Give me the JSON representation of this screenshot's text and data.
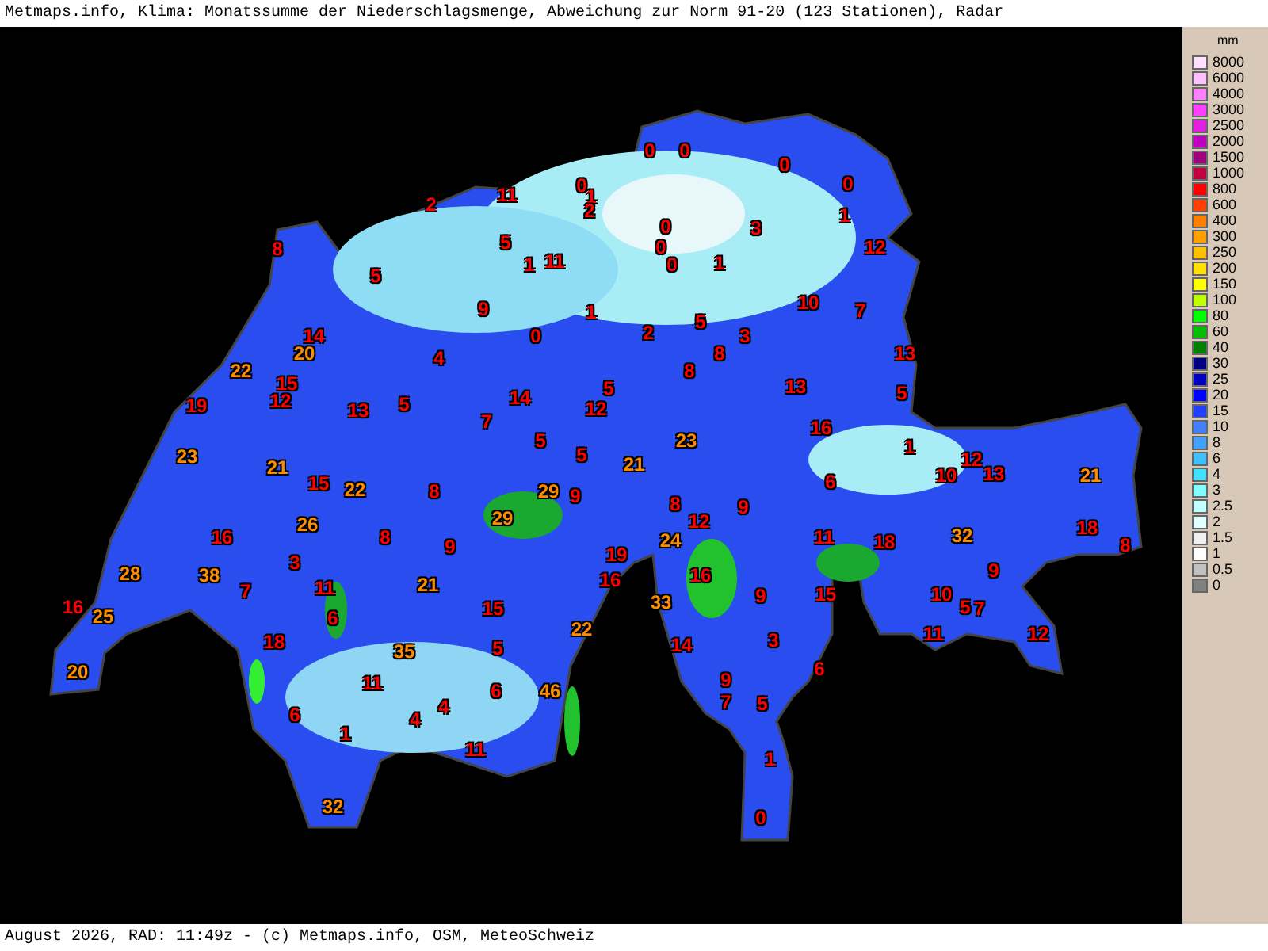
{
  "title": "Metmaps.info, Klima: Monatssumme der Niederschlagsmenge, Abweichung zur Norm 91-20 (123 Stationen), Radar",
  "legend": {
    "unit": "mm",
    "items": [
      {
        "label": "8000",
        "color": "#ffe0ff"
      },
      {
        "label": "6000",
        "color": "#ffc0ff"
      },
      {
        "label": "4000",
        "color": "#ff80ff"
      },
      {
        "label": "3000",
        "color": "#ff40ff"
      },
      {
        "label": "2500",
        "color": "#e020e0"
      },
      {
        "label": "2000",
        "color": "#c000c0"
      },
      {
        "label": "1500",
        "color": "#a00080"
      },
      {
        "label": "1000",
        "color": "#c00040"
      },
      {
        "label": "800",
        "color": "#ff0000"
      },
      {
        "label": "600",
        "color": "#ff4000"
      },
      {
        "label": "400",
        "color": "#ff8000"
      },
      {
        "label": "300",
        "color": "#ffa000"
      },
      {
        "label": "250",
        "color": "#ffc000"
      },
      {
        "label": "200",
        "color": "#ffe000"
      },
      {
        "label": "150",
        "color": "#ffff00"
      },
      {
        "label": "100",
        "color": "#c0ff00"
      },
      {
        "label": "80",
        "color": "#00ff00"
      },
      {
        "label": "60",
        "color": "#00c000"
      },
      {
        "label": "40",
        "color": "#008000"
      },
      {
        "label": "30",
        "color": "#000080"
      },
      {
        "label": "25",
        "color": "#0000c0"
      },
      {
        "label": "20",
        "color": "#0000ff"
      },
      {
        "label": "15",
        "color": "#2040ff"
      },
      {
        "label": "10",
        "color": "#4080ff"
      },
      {
        "label": "8",
        "color": "#40a0ff"
      },
      {
        "label": "6",
        "color": "#40c0ff"
      },
      {
        "label": "4",
        "color": "#40e0ff"
      },
      {
        "label": "3",
        "color": "#80ffff"
      },
      {
        "label": "2.5",
        "color": "#c0ffff"
      },
      {
        "label": "2",
        "color": "#e0ffff"
      },
      {
        "label": "1.5",
        "color": "#f0f0f0"
      },
      {
        "label": "1",
        "color": "#ffffff"
      },
      {
        "label": "0.5",
        "color": "#c0c0c0"
      },
      {
        "label": "0",
        "color": "#808080"
      }
    ]
  },
  "stations": [
    {
      "value": "0",
      "color": "#ff0000"
    },
    {
      "value": "0",
      "color": "#ff0000"
    },
    {
      "value": "0",
      "color": "#ff0000"
    },
    {
      "value": "0",
      "color": "#ff0000"
    },
    {
      "value": "1",
      "color": "#ff0000"
    },
    {
      "value": "11",
      "color": "#ff0000"
    },
    {
      "value": "0",
      "color": "#ff0000"
    },
    {
      "value": "1",
      "color": "#ff0000"
    },
    {
      "value": "2",
      "color": "#ff0000"
    },
    {
      "value": "2",
      "color": "#ff0000"
    },
    {
      "value": "8",
      "color": "#ff0000"
    },
    {
      "value": "5",
      "color": "#ff0000"
    },
    {
      "value": "5",
      "color": "#ff0000"
    },
    {
      "value": "1",
      "color": "#ff0000"
    },
    {
      "value": "11",
      "color": "#ff0000"
    },
    {
      "value": "0",
      "color": "#ff0000"
    },
    {
      "value": "0",
      "color": "#ff0000"
    },
    {
      "value": "0",
      "color": "#ff0000"
    },
    {
      "value": "1",
      "color": "#ff0000"
    },
    {
      "value": "3",
      "color": "#ff0000"
    },
    {
      "value": "12",
      "color": "#ff0000"
    },
    {
      "value": "9",
      "color": "#ff0000"
    },
    {
      "value": "1",
      "color": "#ff0000"
    },
    {
      "value": "0",
      "color": "#ff0000"
    },
    {
      "value": "2",
      "color": "#ff0000"
    },
    {
      "value": "5",
      "color": "#ff0000"
    },
    {
      "value": "3",
      "color": "#ff0000"
    },
    {
      "value": "8",
      "color": "#ff0000"
    },
    {
      "value": "8",
      "color": "#ff0000"
    },
    {
      "value": "10",
      "color": "#ff0000"
    },
    {
      "value": "7",
      "color": "#ff0000"
    },
    {
      "value": "14",
      "color": "#ff0000"
    },
    {
      "value": "20",
      "color": "#ff8c00"
    },
    {
      "value": "4",
      "color": "#ff0000"
    },
    {
      "value": "22",
      "color": "#ff8c00"
    },
    {
      "value": "15",
      "color": "#ff0000"
    },
    {
      "value": "19",
      "color": "#ff0000"
    },
    {
      "value": "12",
      "color": "#ff0000"
    },
    {
      "value": "13",
      "color": "#ff0000"
    },
    {
      "value": "5",
      "color": "#ff0000"
    },
    {
      "value": "14",
      "color": "#ff0000"
    },
    {
      "value": "5",
      "color": "#ff0000"
    },
    {
      "value": "7",
      "color": "#ff0000"
    },
    {
      "value": "12",
      "color": "#ff0000"
    },
    {
      "value": "5",
      "color": "#ff0000"
    },
    {
      "value": "5",
      "color": "#ff0000"
    },
    {
      "value": "13",
      "color": "#ff0000"
    },
    {
      "value": "13",
      "color": "#ff0000"
    },
    {
      "value": "5",
      "color": "#ff0000"
    },
    {
      "value": "16",
      "color": "#ff0000"
    },
    {
      "value": "23",
      "color": "#ff8c00"
    },
    {
      "value": "21",
      "color": "#ff8c00"
    },
    {
      "value": "23",
      "color": "#ff8c00"
    },
    {
      "value": "21",
      "color": "#ff8c00"
    },
    {
      "value": "1",
      "color": "#ff0000"
    },
    {
      "value": "6",
      "color": "#ff0000"
    },
    {
      "value": "10",
      "color": "#ff0000"
    },
    {
      "value": "12",
      "color": "#ff0000"
    },
    {
      "value": "13",
      "color": "#ff0000"
    },
    {
      "value": "21",
      "color": "#ff8c00"
    },
    {
      "value": "15",
      "color": "#ff0000"
    },
    {
      "value": "22",
      "color": "#ff8c00"
    },
    {
      "value": "8",
      "color": "#ff0000"
    },
    {
      "value": "29",
      "color": "#ff8c00"
    },
    {
      "value": "9",
      "color": "#ff0000"
    },
    {
      "value": "29",
      "color": "#ff8c00"
    },
    {
      "value": "16",
      "color": "#ff0000"
    },
    {
      "value": "26",
      "color": "#ff8c00"
    },
    {
      "value": "8",
      "color": "#ff0000"
    },
    {
      "value": "9",
      "color": "#ff0000"
    },
    {
      "value": "8",
      "color": "#ff0000"
    },
    {
      "value": "12",
      "color": "#ff0000"
    },
    {
      "value": "24",
      "color": "#ff8c00"
    },
    {
      "value": "9",
      "color": "#ff0000"
    },
    {
      "value": "11",
      "color": "#ff0000"
    },
    {
      "value": "18",
      "color": "#ff0000"
    },
    {
      "value": "32",
      "color": "#ff8c00"
    },
    {
      "value": "18",
      "color": "#ff0000"
    },
    {
      "value": "8",
      "color": "#ff0000"
    },
    {
      "value": "19",
      "color": "#ff0000"
    },
    {
      "value": "16",
      "color": "#ff0000"
    },
    {
      "value": "16",
      "color": "#ff0000"
    },
    {
      "value": "3",
      "color": "#ff0000"
    },
    {
      "value": "28",
      "color": "#ff8c00"
    },
    {
      "value": "38",
      "color": "#ff8c00"
    },
    {
      "value": "7",
      "color": "#ff0000"
    },
    {
      "value": "11",
      "color": "#ff0000"
    },
    {
      "value": "21",
      "color": "#ff8c00"
    },
    {
      "value": "15",
      "color": "#ff0000"
    },
    {
      "value": "6",
      "color": "#ff0000"
    },
    {
      "value": "16",
      "color": "#ff0000"
    },
    {
      "value": "25",
      "color": "#ff8c00"
    },
    {
      "value": "9",
      "color": "#ff0000"
    },
    {
      "value": "15",
      "color": "#ff0000"
    },
    {
      "value": "9",
      "color": "#ff0000"
    },
    {
      "value": "10",
      "color": "#ff0000"
    },
    {
      "value": "5",
      "color": "#ff0000"
    },
    {
      "value": "7",
      "color": "#ff0000"
    },
    {
      "value": "33",
      "color": "#ff8c00"
    },
    {
      "value": "22",
      "color": "#ff8c00"
    },
    {
      "value": "18",
      "color": "#ff0000"
    },
    {
      "value": "35",
      "color": "#ff8c00"
    },
    {
      "value": "5",
      "color": "#ff0000"
    },
    {
      "value": "14",
      "color": "#ff0000"
    },
    {
      "value": "3",
      "color": "#ff0000"
    },
    {
      "value": "11",
      "color": "#ff0000"
    },
    {
      "value": "12",
      "color": "#ff0000"
    },
    {
      "value": "20",
      "color": "#ff8c00"
    },
    {
      "value": "6",
      "color": "#ff0000"
    },
    {
      "value": "1",
      "color": "#ff0000"
    },
    {
      "value": "11",
      "color": "#ff0000"
    },
    {
      "value": "4",
      "color": "#ff0000"
    },
    {
      "value": "4",
      "color": "#ff0000"
    },
    {
      "value": "6",
      "color": "#ff0000"
    },
    {
      "value": "46",
      "color": "#ff8c00"
    },
    {
      "value": "9",
      "color": "#ff0000"
    },
    {
      "value": "7",
      "color": "#ff0000"
    },
    {
      "value": "5",
      "color": "#ff0000"
    },
    {
      "value": "6",
      "color": "#ff0000"
    },
    {
      "value": "11",
      "color": "#ff0000"
    },
    {
      "value": "1",
      "color": "#ff0000"
    },
    {
      "value": "32",
      "color": "#ff8c00"
    },
    {
      "value": "0",
      "color": "#ff0000"
    }
  ],
  "footer": "August 2026, RAD: 11:49z - (c) Metmaps.info, OSM, MeteoSchweiz"
}
